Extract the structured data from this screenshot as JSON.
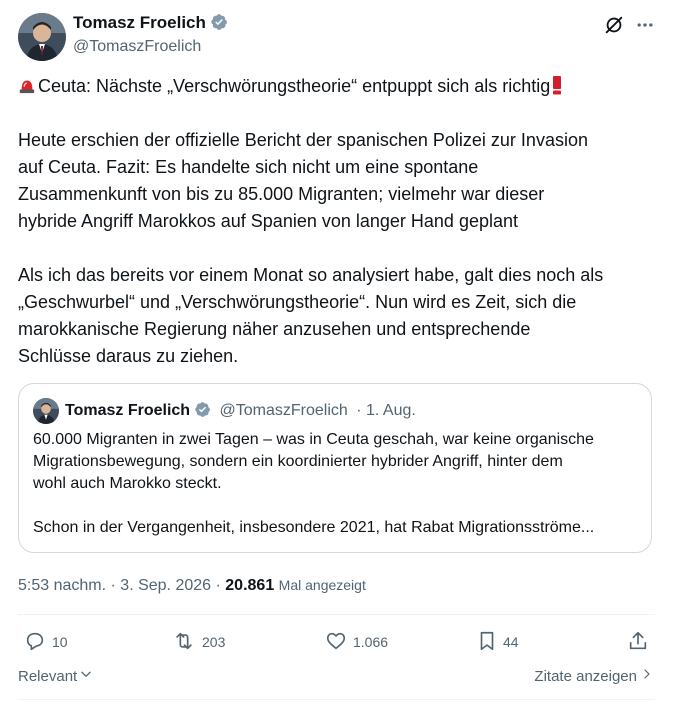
{
  "author": {
    "name": "Tomasz Froelich",
    "handle": "@TomaszFroelich"
  },
  "post": {
    "line1_text": "Ceuta: Nächste „Verschwörungstheorie“ entpuppt sich als richtig",
    "paragraph2": [
      "Heute erschien der offizielle Bericht der spanischen Polizei zur Invasion",
      "auf Ceuta. Fazit: Es handelte sich nicht um eine spontane",
      "Zusammenkunft von bis zu 85.000 Migranten; vielmehr war dieser",
      "hybride Angriff Marokkos auf Spanien von langer Hand geplant"
    ],
    "paragraph3": [
      "Als ich das bereits vor einem Monat so analysiert habe, galt dies noch als",
      "„Geschwurbel“ und „Verschwörungstheorie“. Nun wird es Zeit, sich die",
      "marokkanische Regierung näher anzusehen und entsprechende",
      "Schlüsse daraus zu ziehen."
    ]
  },
  "quoted": {
    "name": "Tomasz Froelich",
    "handle": "@TomaszFroelich",
    "date": "· 1. Aug.",
    "lines": [
      "60.000 Migranten in zwei Tagen – was in Ceuta geschah, war keine organische",
      "Migrationsbewegung, sondern ein koordinierter hybrider Angriff, hinter dem",
      "wohl auch Marokko steckt.",
      "",
      "Schon in der Vergangenheit, insbesondere 2021, hat Rabat Migrationsströme..."
    ]
  },
  "meta": {
    "time": "5:53 nachm.",
    "date": "3. Sep. 2026",
    "views": "20.861",
    "views_label": "Mal angezeigt"
  },
  "actions": {
    "replies": "10",
    "reposts": "203",
    "likes": "1.066",
    "bookmarks": "44"
  },
  "footer": {
    "sort_label": "Relevant",
    "quotes_label": "Zitate anzeigen"
  },
  "colors": {
    "verified": "#1d9bf0",
    "muted": "#536471",
    "text": "#0f1419"
  }
}
